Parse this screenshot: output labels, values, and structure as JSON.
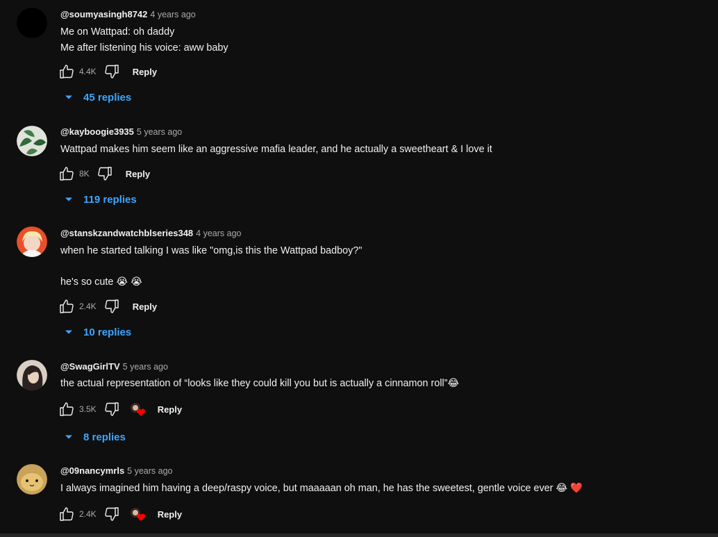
{
  "colors": {
    "background": "#0f0f0f",
    "text": "#f1f1f1",
    "meta": "#aaaaaa",
    "replies_link": "#3ea6ff",
    "heart": "#ff0000"
  },
  "comments": [
    {
      "author": "@soumyasingh8742",
      "time": "4 years ago",
      "lines": [
        "Me on Wattpad: oh daddy",
        "Me after listening his voice: aww baby"
      ],
      "likes": "4.4K",
      "reply_label": "Reply",
      "replies_label": "45 replies",
      "creator_heart": false,
      "avatar": "black-circle-avatar"
    },
    {
      "author": "@kayboogie3935",
      "time": "5 years ago",
      "lines": [
        "Wattpad makes him seem like an aggressive mafia leader, and he actually a sweetheart & I love it"
      ],
      "likes": "8K",
      "reply_label": "Reply",
      "replies_label": "119 replies",
      "creator_heart": false,
      "avatar": "green-plant-avatar"
    },
    {
      "author": "@stanskzandwatchblseries348",
      "time": "4 years ago",
      "lines": [
        "when he started talking I was like \"omg,is this the Wattpad badboy?\"",
        "",
        "he's so cute 😭 😭"
      ],
      "likes": "2.4K",
      "reply_label": "Reply",
      "replies_label": "10 replies",
      "creator_heart": false,
      "avatar": "blond-person-avatar"
    },
    {
      "author": "@SwagGirlTV",
      "time": "5 years ago",
      "lines": [
        "the actual representation of “looks like they could kill you but is actually a cinnamon roll”😂"
      ],
      "likes": "3.5K",
      "reply_label": "Reply",
      "replies_label": "8 replies",
      "creator_heart": true,
      "avatar": "dark-hair-person-avatar"
    },
    {
      "author": "@09nancymrls",
      "time": "5 years ago",
      "lines": [
        "I always imagined him having a deep/raspy voice, but maaaaan oh man, he has the sweetest, gentle voice ever 😂 ❤️"
      ],
      "likes": "2.4K",
      "reply_label": "Reply",
      "replies_label": "",
      "creator_heart": true,
      "avatar": "pikachu-avatar"
    }
  ]
}
